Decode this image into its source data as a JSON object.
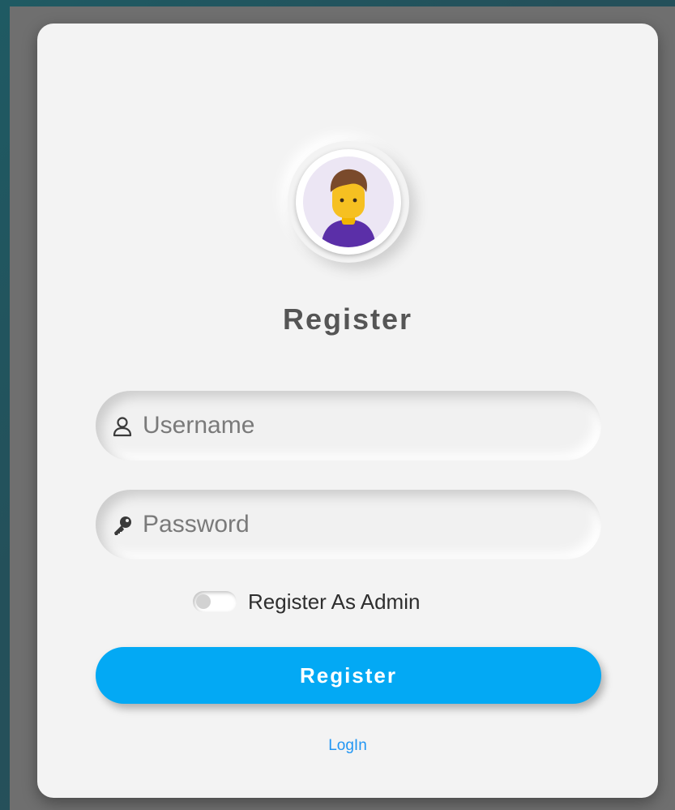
{
  "form": {
    "title": "Register",
    "username_placeholder": "Username",
    "password_placeholder": "Password",
    "admin_toggle_label": "Register As Admin",
    "admin_toggle_on": false,
    "submit_label": "Register",
    "login_link": "LogIn"
  },
  "icons": {
    "avatar": "user-avatar-icon",
    "username": "user-icon",
    "password": "key-icon"
  },
  "colors": {
    "accent": "#03a9f4",
    "link": "#2196f3",
    "card": "#f3f3f3",
    "title": "#555555"
  }
}
